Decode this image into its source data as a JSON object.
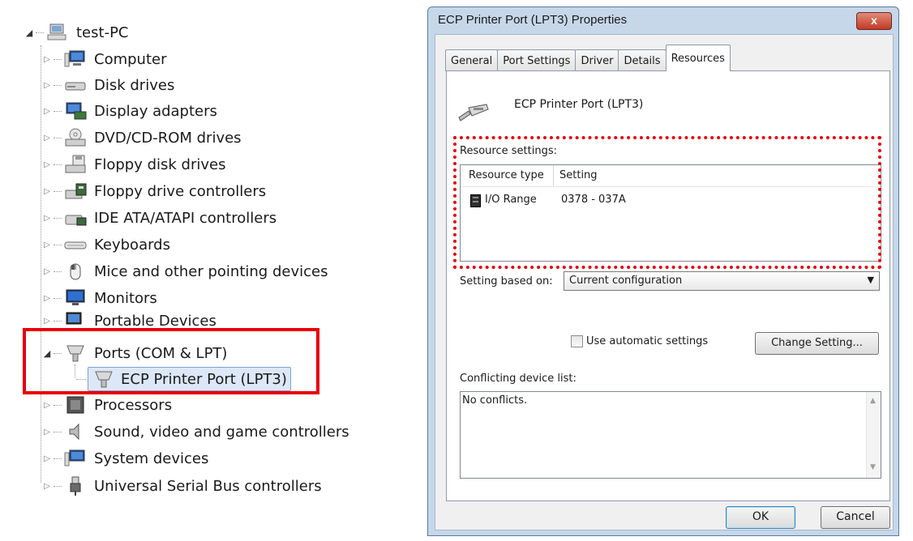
{
  "device_tree": {
    "root": "test-PC",
    "items": [
      {
        "label": "Computer",
        "icon": "computer-icon",
        "state": "collapsed"
      },
      {
        "label": "Disk drives",
        "icon": "disk-drive-icon",
        "state": "collapsed"
      },
      {
        "label": "Display adapters",
        "icon": "display-adapter-icon",
        "state": "collapsed"
      },
      {
        "label": "DVD/CD-ROM drives",
        "icon": "dvd-drive-icon",
        "state": "collapsed"
      },
      {
        "label": "Floppy disk drives",
        "icon": "floppy-drive-icon",
        "state": "collapsed"
      },
      {
        "label": "Floppy drive controllers",
        "icon": "floppy-controller-icon",
        "state": "collapsed"
      },
      {
        "label": "IDE ATA/ATAPI controllers",
        "icon": "ide-controller-icon",
        "state": "collapsed"
      },
      {
        "label": "Keyboards",
        "icon": "keyboard-icon",
        "state": "collapsed"
      },
      {
        "label": "Mice and other pointing devices",
        "icon": "mouse-icon",
        "state": "collapsed"
      },
      {
        "label": "Monitors",
        "icon": "monitor-icon",
        "state": "collapsed"
      },
      {
        "label": "Portable Devices",
        "icon": "portable-device-icon",
        "state": "collapsed"
      },
      {
        "label": "Ports (COM & LPT)",
        "icon": "port-icon",
        "state": "expanded"
      },
      {
        "label": "ECP Printer Port (LPT3)",
        "icon": "port-icon",
        "state": "child-selected"
      },
      {
        "label": "Processors",
        "icon": "processor-icon",
        "state": "collapsed"
      },
      {
        "label": "Sound, video and game controllers",
        "icon": "speaker-icon",
        "state": "collapsed"
      },
      {
        "label": "System devices",
        "icon": "system-device-icon",
        "state": "collapsed"
      },
      {
        "label": "Universal Serial Bus controllers",
        "icon": "usb-icon",
        "state": "collapsed"
      }
    ]
  },
  "dialog": {
    "title": "ECP Printer Port (LPT3) Properties",
    "close_label": "x",
    "tabs": [
      "General",
      "Port Settings",
      "Driver",
      "Details",
      "Resources"
    ],
    "active_tab": "Resources",
    "device_name": "ECP Printer Port (LPT3)",
    "resource_settings_label": "Resource settings:",
    "resource_columns": [
      "Resource type",
      "Setting"
    ],
    "resources": [
      {
        "type": "I/O Range",
        "setting": "0378 - 037A"
      }
    ],
    "setting_based_on_label": "Setting based on:",
    "setting_based_on_value": "Current configuration",
    "use_automatic_label": "Use automatic settings",
    "use_automatic_checked": false,
    "change_setting_label": "Change Setting...",
    "conflicting_label": "Conflicting device list:",
    "conflicting_text": "No conflicts.",
    "ok_label": "OK",
    "cancel_label": "Cancel"
  },
  "colors": {
    "highlight_red": "#e8000b",
    "selection_blue": "#dce8f7",
    "dialog_frame": "#c6d7ea",
    "close_button": "#c23a25"
  }
}
